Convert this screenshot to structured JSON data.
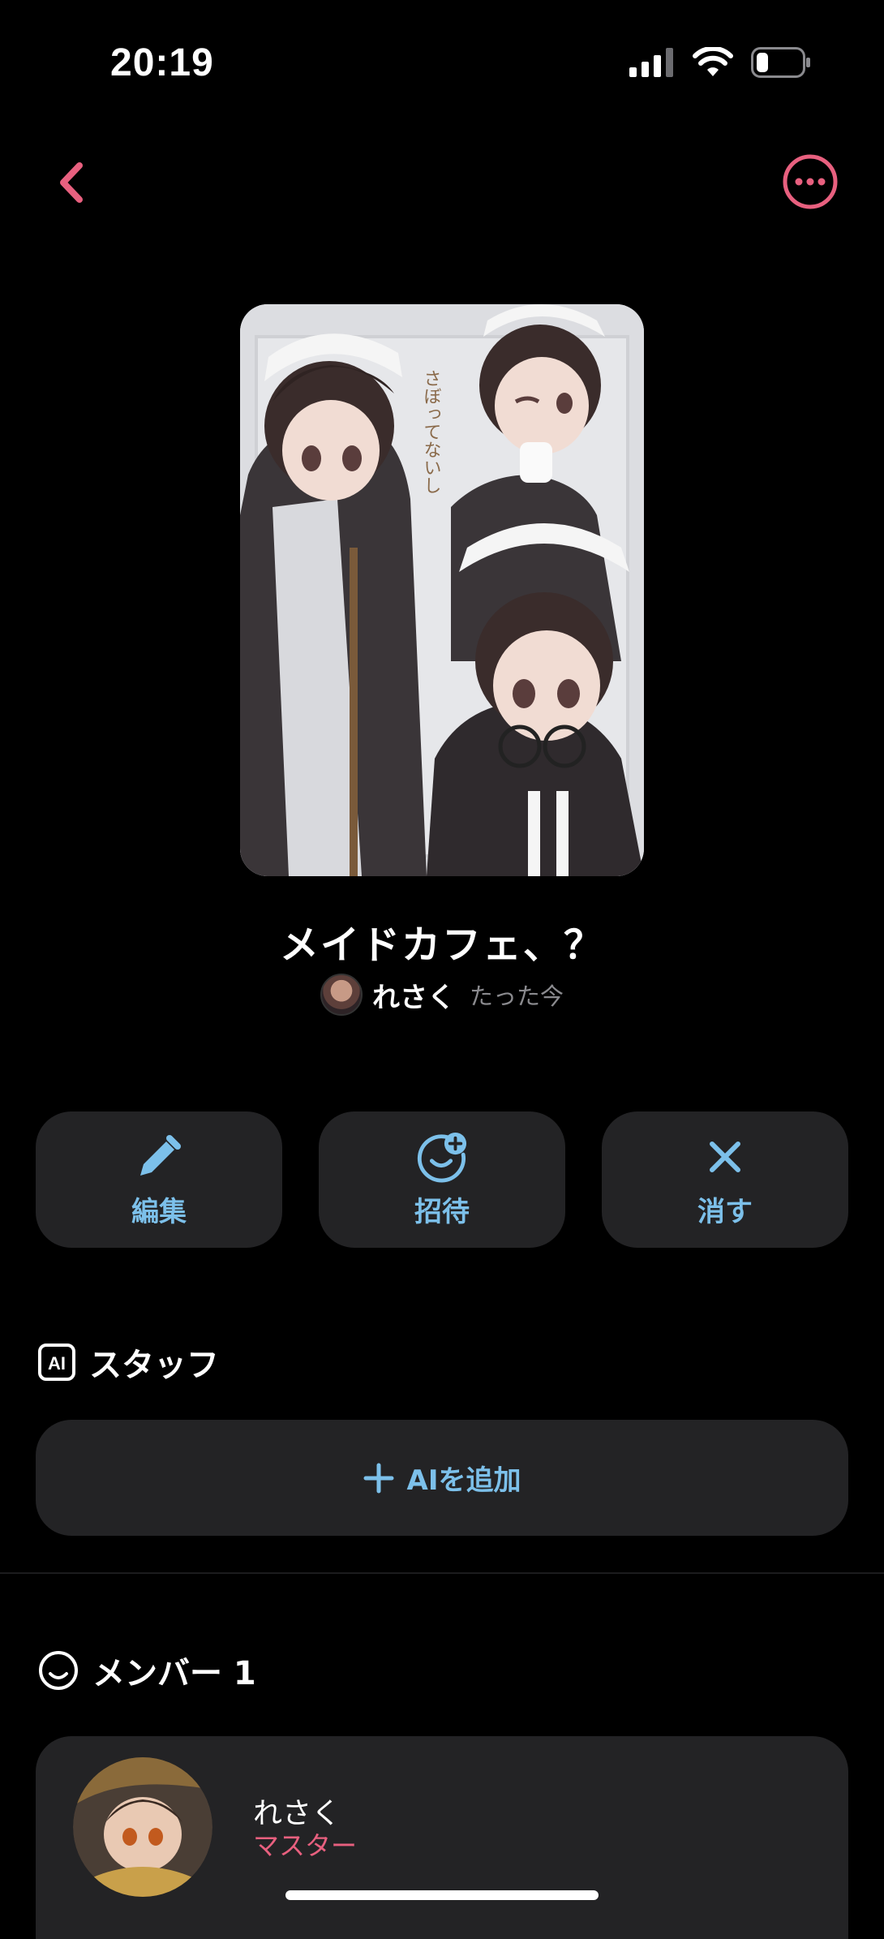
{
  "status_bar": {
    "time": "20:19"
  },
  "nav": {
    "back_icon": "chevron-left-icon",
    "more_icon": "more-horizontal-circle-icon",
    "accent_color": "#e8607f"
  },
  "room": {
    "title": "メイドカフェ、？",
    "cover_text": "さぼってないし",
    "owner_name": "れさく",
    "time": "たった今"
  },
  "actions": [
    {
      "label": "編集",
      "icon": "pencil-icon"
    },
    {
      "label": "招待",
      "icon": "add-person-icon"
    },
    {
      "label": "消す",
      "icon": "close-icon"
    }
  ],
  "staff_section": {
    "title": "スタッフ",
    "icon_text": "AI",
    "add_label": "AIを追加"
  },
  "members_section": {
    "title": "メンバー 1",
    "members": [
      {
        "name": "れさく",
        "role": "マスター"
      }
    ]
  },
  "colors": {
    "action_text": "#7cc0ea",
    "role_text": "#e8607f",
    "card_bg": "#232325"
  }
}
